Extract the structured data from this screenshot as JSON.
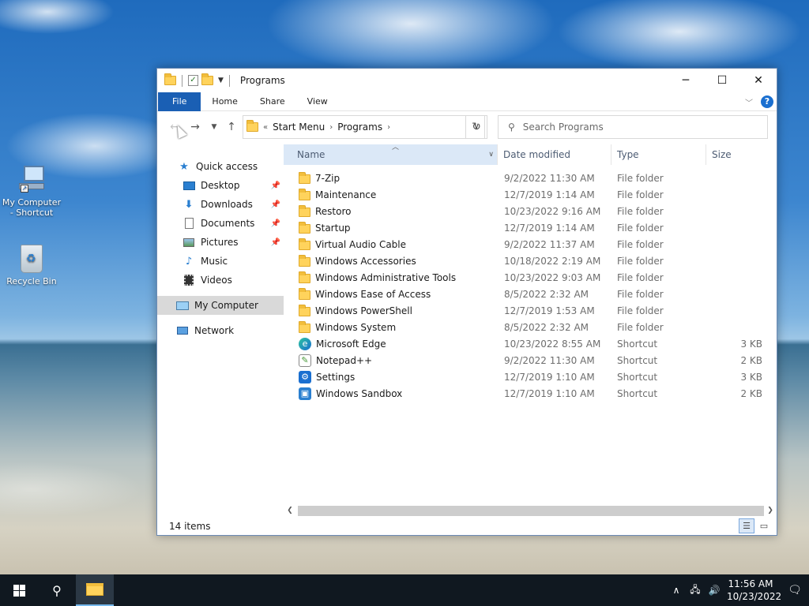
{
  "desktop": {
    "icons": [
      {
        "label": "My Computer - Shortcut"
      },
      {
        "label": "Recycle Bin"
      }
    ]
  },
  "window": {
    "title": "Programs",
    "ribbon_tabs": [
      "File",
      "Home",
      "Share",
      "View"
    ],
    "address": {
      "prefix": "«",
      "crumbs": [
        "Start Menu",
        "Programs"
      ]
    },
    "search_placeholder": "Search Programs",
    "nav_pane": [
      {
        "label": "Quick access",
        "icon": "star-icon",
        "pinned": false
      },
      {
        "label": "Desktop",
        "icon": "desktop-icon",
        "pinned": true
      },
      {
        "label": "Downloads",
        "icon": "download-icon",
        "pinned": true
      },
      {
        "label": "Documents",
        "icon": "document-icon",
        "pinned": true
      },
      {
        "label": "Pictures",
        "icon": "picture-icon",
        "pinned": true
      },
      {
        "label": "Music",
        "icon": "music-icon",
        "pinned": false
      },
      {
        "label": "Videos",
        "icon": "video-icon",
        "pinned": false
      },
      {
        "label": "My Computer",
        "icon": "computer-icon",
        "pinned": false
      },
      {
        "label": "Network",
        "icon": "network-icon",
        "pinned": false
      }
    ],
    "columns": {
      "name": "Name",
      "date": "Date modified",
      "type": "Type",
      "size": "Size"
    },
    "rows": [
      {
        "name": "7-Zip",
        "date": "9/2/2022 11:30 AM",
        "type": "File folder",
        "size": "",
        "icon": "folder-icon"
      },
      {
        "name": "Maintenance",
        "date": "12/7/2019 1:14 AM",
        "type": "File folder",
        "size": "",
        "icon": "folder-icon"
      },
      {
        "name": "Restoro",
        "date": "10/23/2022 9:16 AM",
        "type": "File folder",
        "size": "",
        "icon": "folder-icon"
      },
      {
        "name": "Startup",
        "date": "12/7/2019 1:14 AM",
        "type": "File folder",
        "size": "",
        "icon": "folder-icon"
      },
      {
        "name": "Virtual Audio Cable",
        "date": "9/2/2022 11:37 AM",
        "type": "File folder",
        "size": "",
        "icon": "folder-icon"
      },
      {
        "name": "Windows Accessories",
        "date": "10/18/2022 2:19 AM",
        "type": "File folder",
        "size": "",
        "icon": "folder-icon"
      },
      {
        "name": "Windows Administrative Tools",
        "date": "10/23/2022 9:03 AM",
        "type": "File folder",
        "size": "",
        "icon": "folder-icon"
      },
      {
        "name": "Windows Ease of Access",
        "date": "8/5/2022 2:32 AM",
        "type": "File folder",
        "size": "",
        "icon": "folder-icon"
      },
      {
        "name": "Windows PowerShell",
        "date": "12/7/2019 1:53 AM",
        "type": "File folder",
        "size": "",
        "icon": "folder-icon"
      },
      {
        "name": "Windows System",
        "date": "8/5/2022 2:32 AM",
        "type": "File folder",
        "size": "",
        "icon": "folder-icon"
      },
      {
        "name": "Microsoft Edge",
        "date": "10/23/2022 8:55 AM",
        "type": "Shortcut",
        "size": "3 KB",
        "icon": "edge-icon"
      },
      {
        "name": "Notepad++",
        "date": "9/2/2022 11:30 AM",
        "type": "Shortcut",
        "size": "2 KB",
        "icon": "notepad-icon"
      },
      {
        "name": "Settings",
        "date": "12/7/2019 1:10 AM",
        "type": "Shortcut",
        "size": "3 KB",
        "icon": "settings-icon"
      },
      {
        "name": "Windows Sandbox",
        "date": "12/7/2019 1:10 AM",
        "type": "Shortcut",
        "size": "2 KB",
        "icon": "sandbox-icon"
      }
    ],
    "status": "14 items"
  },
  "taskbar": {
    "time": "11:56 AM",
    "date": "10/23/2022"
  },
  "colors": {
    "accent": "#1a5fb4",
    "folder": "#ffd35c",
    "selection": "#dbe8f7"
  }
}
